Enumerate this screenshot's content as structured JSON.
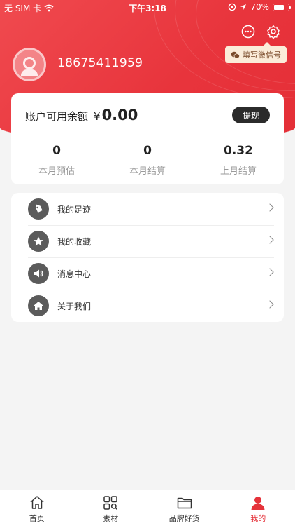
{
  "status_bar": {
    "carrier": "无 SIM 卡",
    "time": "下午3:18",
    "battery": "70%",
    "battery_level": 0.7
  },
  "header": {
    "tooltip": "填写微信号",
    "phone": "18675411959"
  },
  "balance": {
    "label": "账户可用余额",
    "currency": "¥",
    "amount": "0.00",
    "withdraw_label": "提现"
  },
  "stats": [
    {
      "value": "0",
      "label": "本月预估"
    },
    {
      "value": "0",
      "label": "本月结算"
    },
    {
      "value": "0.32",
      "label": "上月结算"
    }
  ],
  "menu": [
    {
      "label": "我的足迹",
      "icon": "tag-icon"
    },
    {
      "label": "我的收藏",
      "icon": "star-icon"
    },
    {
      "label": "消息中心",
      "icon": "speaker-icon"
    },
    {
      "label": "关于我们",
      "icon": "home-icon"
    }
  ],
  "tabs": [
    {
      "label": "首页",
      "icon": "home-outline-icon"
    },
    {
      "label": "素材",
      "icon": "grid-search-icon"
    },
    {
      "label": "品牌好货",
      "icon": "folder-icon"
    },
    {
      "label": "我的",
      "icon": "user-icon"
    }
  ],
  "colors": {
    "accent": "#e5323a",
    "header": "#ec3c43",
    "tooltip_bg": "#fbecd9"
  }
}
